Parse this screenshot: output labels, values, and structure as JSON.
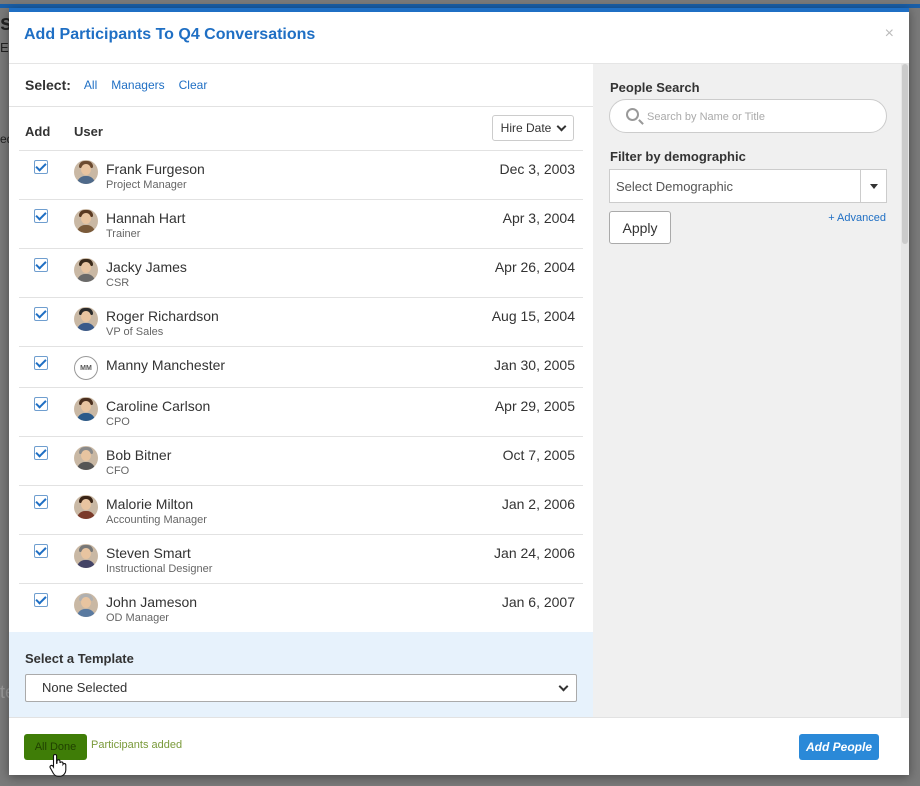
{
  "background": {
    "title_char": "s",
    "sub_char": "Ed",
    "side_char": "ed",
    "bottom_char": "te"
  },
  "modal": {
    "title": "Add Participants To Q4 Conversations",
    "close": "×"
  },
  "select_bar": {
    "label": "Select:",
    "all": "All",
    "managers": "Managers",
    "clear": "Clear"
  },
  "list": {
    "col_add": "Add",
    "col_user": "User",
    "sort_label": "Hire Date",
    "rows": [
      {
        "name": "Frank Furgeson",
        "title": "Project Manager",
        "date": "Dec 3, 2003",
        "checked": true
      },
      {
        "name": "Hannah Hart",
        "title": "Trainer",
        "date": "Apr 3, 2004",
        "checked": true
      },
      {
        "name": "Jacky James",
        "title": "CSR",
        "date": "Apr 26, 2004",
        "checked": true
      },
      {
        "name": "Roger Richardson",
        "title": "VP of Sales",
        "date": "Aug 15, 2004",
        "checked": true
      },
      {
        "name": "Manny Manchester",
        "title": "",
        "date": "Jan 30, 2005",
        "checked": true,
        "initials": "MM"
      },
      {
        "name": "Caroline Carlson",
        "title": "CPO",
        "date": "Apr 29, 2005",
        "checked": true
      },
      {
        "name": "Bob Bitner",
        "title": "CFO",
        "date": "Oct 7, 2005",
        "checked": true
      },
      {
        "name": "Malorie Milton",
        "title": "Accounting Manager",
        "date": "Jan 2, 2006",
        "checked": true
      },
      {
        "name": "Steven Smart",
        "title": "Instructional Designer",
        "date": "Jan 24, 2006",
        "checked": true
      },
      {
        "name": "John Jameson",
        "title": "OD Manager",
        "date": "Jan 6, 2007",
        "checked": true
      }
    ]
  },
  "template": {
    "label": "Select a Template",
    "selected": "None Selected"
  },
  "search": {
    "label": "People Search",
    "placeholder": "Search by Name or Title",
    "filter_label": "Filter by demographic",
    "demographic": "Select Demographic",
    "advanced": "+ Advanced",
    "apply": "Apply"
  },
  "footer": {
    "done": "All Done",
    "status": "Participants added",
    "add_people": "Add People"
  },
  "colors": {
    "accent": "#1f6fc4",
    "done_green": "#3f7d07",
    "add_blue": "#2a89d8",
    "template_bg": "#e7f2fc"
  }
}
